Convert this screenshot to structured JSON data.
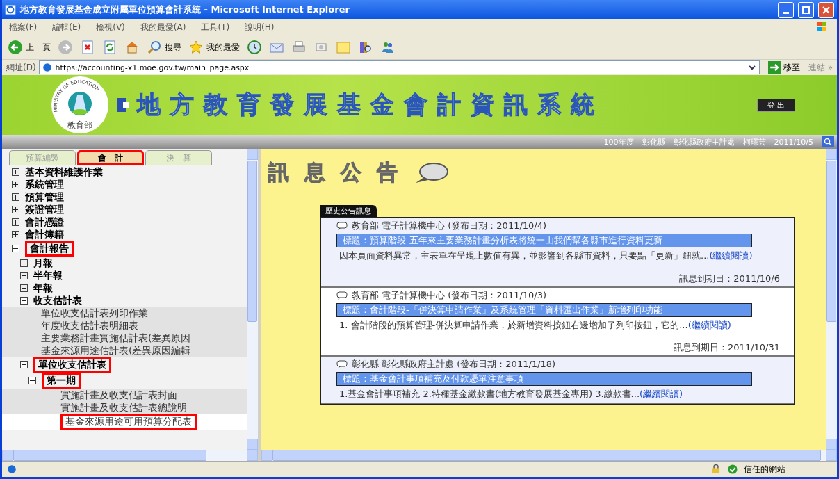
{
  "window": {
    "title": "地方教育發展基金成立附屬單位預算會計系統 - Microsoft Internet Explorer"
  },
  "menu": [
    "檔案(F)",
    "編輯(E)",
    "檢視(V)",
    "我的最愛(A)",
    "工具(T)",
    "說明(H)"
  ],
  "toolbar": [
    {
      "kind": "back",
      "label": "上一頁"
    },
    {
      "kind": "forward"
    },
    {
      "kind": "stop"
    },
    {
      "kind": "refresh"
    },
    {
      "kind": "home"
    },
    {
      "kind": "search",
      "label": "搜尋"
    },
    {
      "kind": "favorites",
      "label": "我的最愛"
    },
    {
      "kind": "history"
    },
    {
      "kind": "mail"
    },
    {
      "kind": "print"
    },
    {
      "kind": "edit"
    },
    {
      "kind": "note"
    },
    {
      "kind": "research"
    },
    {
      "kind": "messenger"
    }
  ],
  "address": {
    "label": "網址(D)",
    "url": "https://accounting-x1.moe.gov.tw/main_page.aspx",
    "go": "移至",
    "links": "連結",
    "more": "»"
  },
  "banner": {
    "logo_arc": "MINISTRY OF EDUCATION",
    "logo_name": "教育部",
    "title": "地方教育發展基金會計資訊系統",
    "logout": "登 出"
  },
  "info_bar": [
    "100年度",
    "彰化縣",
    "彰化縣政府主計處",
    "柯璟芸",
    "2011/10/5"
  ],
  "tabs": [
    {
      "label": "預算編製",
      "selected": false,
      "annotated": false
    },
    {
      "label": "會　計",
      "selected": true,
      "annotated": true
    },
    {
      "label": "決　算",
      "selected": false,
      "annotated": false
    }
  ],
  "tree": [
    {
      "label": "基本資料維護作業",
      "annotated": false,
      "expanded": false
    },
    {
      "label": "系統管理",
      "annotated": false,
      "expanded": false
    },
    {
      "label": "預算管理",
      "annotated": false,
      "expanded": false
    },
    {
      "label": "簽證管理",
      "annotated": false,
      "expanded": false
    },
    {
      "label": "會計憑證",
      "annotated": false,
      "expanded": false
    },
    {
      "label": "會計簿籍",
      "annotated": false,
      "expanded": false
    },
    {
      "label": "會計報告",
      "annotated": true,
      "expanded": true,
      "children": [
        {
          "label": "月報",
          "annotated": false,
          "expanded": false
        },
        {
          "label": "半年報",
          "annotated": false,
          "expanded": false
        },
        {
          "label": "年報",
          "annotated": false,
          "expanded": false
        },
        {
          "label": "收支估計表",
          "annotated": false,
          "expanded": true,
          "children": [
            {
              "label": "單位收支估計表列印作業",
              "annotated": false,
              "selected": false
            },
            {
              "label": "年度收支估計表明細表",
              "annotated": false,
              "selected": false
            },
            {
              "label": "主要業務計畫實施估計表(差異原因",
              "annotated": false,
              "selected": false
            },
            {
              "label": "基金來源用途估計表(差異原因編輯",
              "annotated": false,
              "selected": false
            }
          ]
        },
        {
          "label": "單位收支估計表",
          "annotated": true,
          "expanded": true,
          "children": [
            {
              "label": "第一期",
              "annotated": true,
              "expanded": true,
              "children": [
                {
                  "label": "實施計畫及收支估計表封面",
                  "annotated": false,
                  "selected": false
                },
                {
                  "label": "實施計畫及收支估計表總說明",
                  "annotated": false,
                  "selected": false
                },
                {
                  "label": "基金來源用途可用預算分配表",
                  "annotated": true,
                  "selected": true
                }
              ]
            }
          ]
        }
      ]
    }
  ],
  "content": {
    "heading": "訊息公告",
    "history_tag": "歷史公告訊息",
    "announcements": [
      {
        "source": "教育部 電子計算機中心 (發布日期：2011/10/4)",
        "title": "標題：預算階段-五年來主要業務計畫分析表將統一由我們幫各縣市進行資料更新",
        "body": "因本頁面資料異常，主表單在呈現上數值有異，並影響到各縣市資料，只要點「更新」鈕就...",
        "more": "(繼續閱讀)",
        "expires": "訊息到期日：2011/10/6"
      },
      {
        "source": "教育部 電子計算機中心 (發布日期：2011/10/3)",
        "title": "標題：會計階段-「併決算申請作業」及系統管理「資料匯出作業」新增列印功能",
        "body": "1. 會計階段的預算管理-併決算申請作業，於新增資料按鈕右邊增加了列印按鈕，它的...",
        "more": "(繼續閱讀)",
        "expires": "訊息到期日：2011/10/31"
      },
      {
        "source": "彰化縣 彰化縣政府主計處 (發布日期：2011/1/18)",
        "title": "標題：基金會計事項補充及付款憑單注意事項",
        "body": "1.基金會計事項補充 2.特種基金繳款書(地方教育發展基金專用) 3.繳款書...",
        "more": "(繼續閱讀)"
      }
    ]
  },
  "status_bar": {
    "zone": "信任的網站"
  }
}
